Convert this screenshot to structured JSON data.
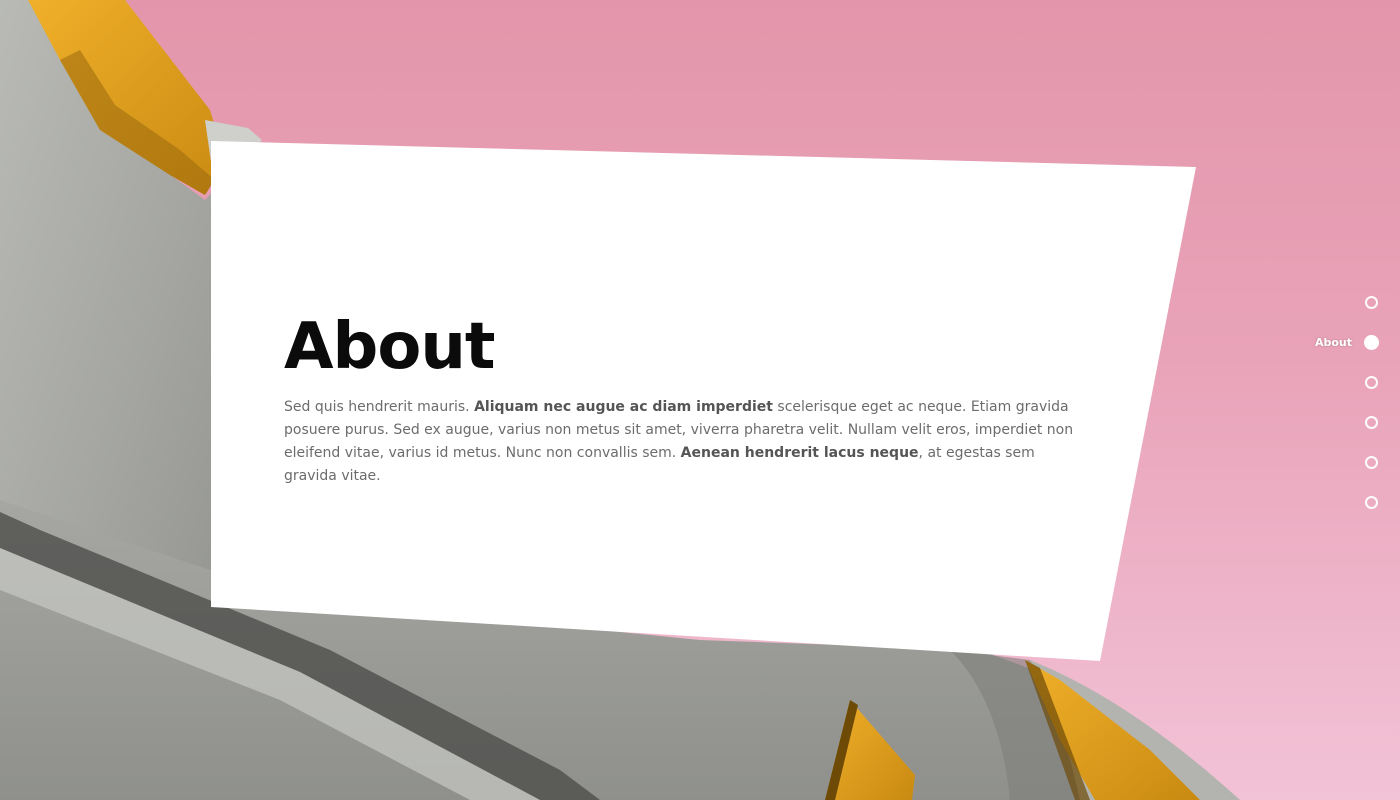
{
  "section": {
    "title": "About",
    "paragraph": [
      {
        "text": "Sed quis hendrerit mauris. ",
        "bold": false
      },
      {
        "text": "Aliquam nec augue ac diam imperdiet",
        "bold": true
      },
      {
        "text": " scelerisque eget ac neque. Etiam gravida posuere purus. Sed ex augue, varius non metus sit amet, viverra pharetra velit. Nullam velit eros, imperdiet non eleifend vitae, varius id metus. Nunc non convallis sem. ",
        "bold": false
      },
      {
        "text": "Aenean hendrerit lacus neque",
        "bold": true
      },
      {
        "text": ", at egestas sem gravida vitae.",
        "bold": false
      }
    ]
  },
  "navigation": {
    "dots": [
      {
        "label": "",
        "active": false
      },
      {
        "label": "About",
        "active": true
      },
      {
        "label": "",
        "active": false
      },
      {
        "label": "",
        "active": false
      },
      {
        "label": "",
        "active": false
      },
      {
        "label": "",
        "active": false
      }
    ]
  },
  "colors": {
    "sky_top": "#e396ab",
    "sky_bottom": "#f2c2d6",
    "concrete": "#9a9b98",
    "accent_yellow": "#e8a522",
    "title": "#0b0b0b",
    "body_text": "#6c6c6c"
  }
}
